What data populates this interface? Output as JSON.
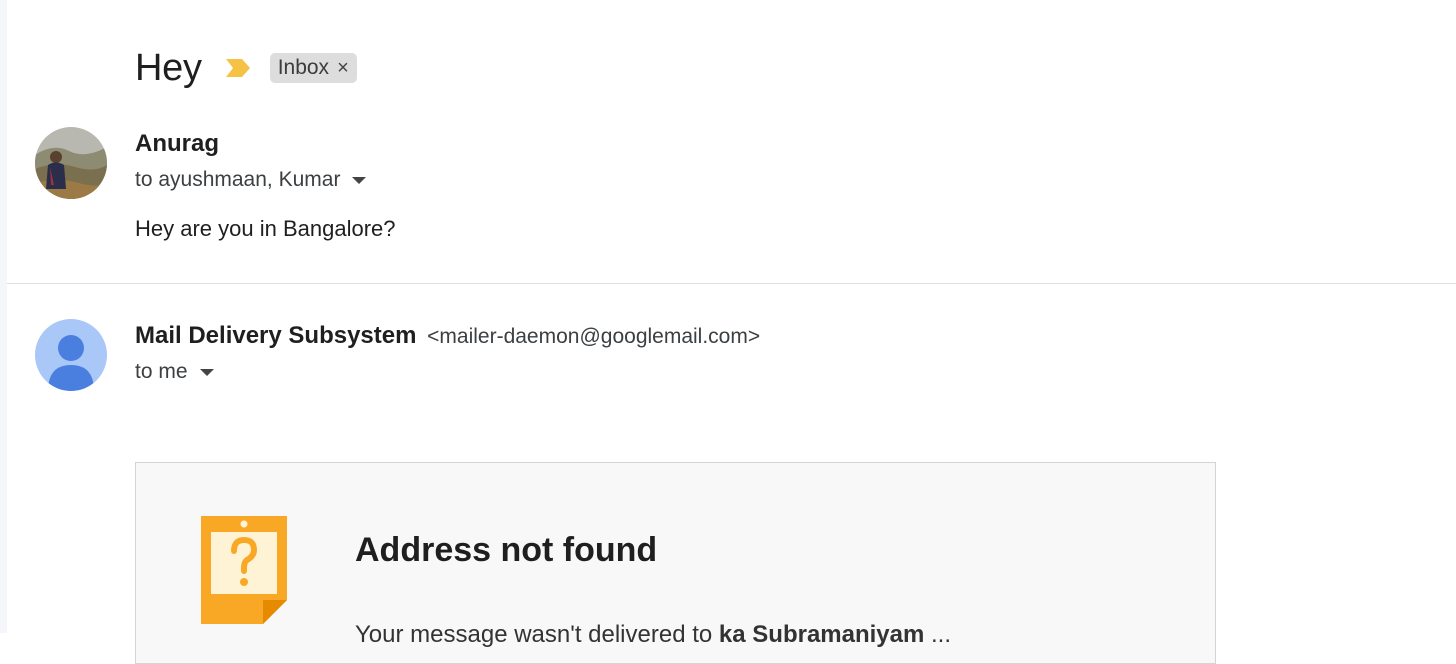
{
  "thread": {
    "subject": "Hey",
    "importance_marker": "important-icon",
    "label": {
      "name": "Inbox",
      "remove_glyph": "×"
    }
  },
  "messages": [
    {
      "sender": "Anurag",
      "recipients": "to ayushmaan, Kumar",
      "body": "Hey are you in Bangalore?",
      "avatar": "profile-photo"
    },
    {
      "sender": "Mail Delivery Subsystem",
      "sender_email": "<mailer-daemon@googlemail.com>",
      "recipients": "to me",
      "avatar": "default-person-icon",
      "bounce": {
        "title": "Address not found",
        "text_start": "Your message wasn't delivered to",
        "text_bold": "ka Subramaniyam",
        "text_end": "...",
        "icon": "question-note-icon"
      }
    }
  ],
  "colors": {
    "importance": "#f6c245",
    "chip_bg": "#dddddd",
    "default_avatar_bg": "#a9c7f7",
    "default_avatar_fg": "#4a7fe0",
    "bounce_icon": "#f9a825",
    "bounce_icon_inner": "#fff3d6"
  }
}
